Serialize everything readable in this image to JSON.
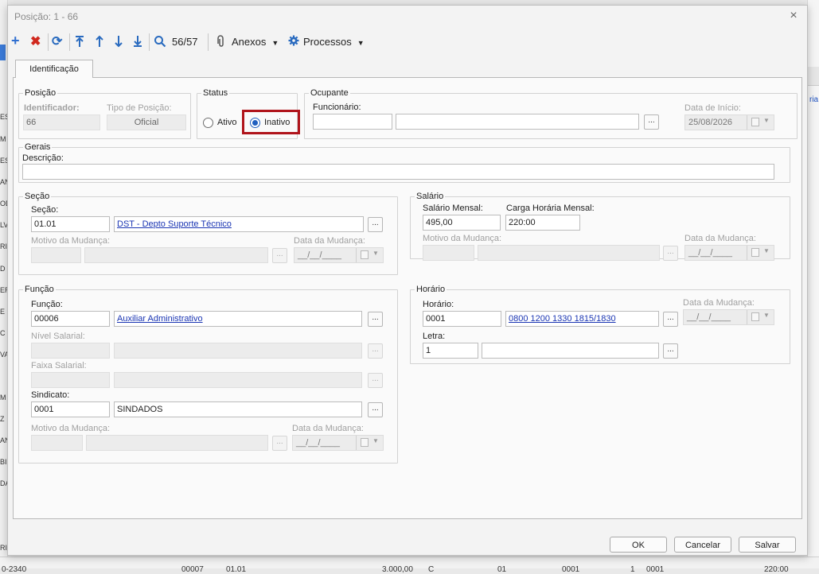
{
  "dialog": {
    "title": "Posição: 1 - 66",
    "close_icon": "×"
  },
  "toolbar": {
    "record_counter": "56/57",
    "anexos_label": "Anexos",
    "processos_label": "Processos",
    "icons": [
      "add-icon",
      "delete-icon",
      "refresh-icon",
      "first-record-icon",
      "previous-record-icon",
      "next-record-icon",
      "last-record-icon",
      "search-icon",
      "paperclip-icon",
      "gear-icon"
    ],
    "colors": {
      "add": "#2f6fd0",
      "delete": "#d0281e",
      "nav": "#2a6bbf"
    }
  },
  "tabs": [
    {
      "label": "Identificação"
    }
  ],
  "posicao": {
    "legend": "Posição",
    "identificador_label": "Identificador:",
    "identificador_value": "66",
    "tipo_label": "Tipo de Posição:",
    "tipo_value": "Oficial"
  },
  "status": {
    "legend": "Status",
    "ativo_label": "Ativo",
    "inativo_label": "Inativo",
    "selected": "Inativo",
    "highlight_color": "#b0141b"
  },
  "ocupante": {
    "legend": "Ocupante",
    "funcionario_label": "Funcionário:",
    "funcionario_code": "",
    "funcionario_name": "",
    "data_inicio_label": "Data de Início:",
    "data_inicio_value": "25/08/2026"
  },
  "gerais": {
    "legend": "Gerais",
    "descricao_label": "Descrição:",
    "descricao_value": ""
  },
  "secao": {
    "legend": "Seção",
    "secao_label": "Seção:",
    "secao_code": "01.01",
    "secao_name": "DST - Depto Suporte Técnico",
    "motivo_label": "Motivo da Mudança:",
    "data_mudanca_label": "Data da Mudança:",
    "data_mudanca_value": "__/__/____"
  },
  "salario": {
    "legend": "Salário",
    "salario_mensal_label": "Salário Mensal:",
    "salario_mensal_value": "495,00",
    "carga_label": "Carga Horária Mensal:",
    "carga_value": "220:00",
    "motivo_label": "Motivo da Mudança:",
    "data_mudanca_label": "Data da Mudança:",
    "data_mudanca_value": "__/__/____"
  },
  "funcao": {
    "legend": "Função",
    "funcao_label": "Função:",
    "funcao_code": "00006",
    "funcao_name": "Auxiliar Administrativo",
    "nivel_label": "Nível Salarial:",
    "faixa_label": "Faixa Salarial:",
    "sindicato_label": "Sindicato:",
    "sindicato_code": "0001",
    "sindicato_name": "SINDADOS",
    "motivo_label": "Motivo da Mudança:",
    "data_mudanca_label": "Data da Mudança:",
    "data_mudanca_value": "__/__/____"
  },
  "horario": {
    "legend": "Horário",
    "horario_label": "Horário:",
    "horario_code": "0001",
    "horario_name": "0800 1200 1330 1815/1830",
    "data_mudanca_label": "Data da Mudança:",
    "data_mudanca_value": "__/__/____",
    "letra_label": "Letra:",
    "letra_value": "1"
  },
  "footer": {
    "ok_label": "OK",
    "cancel_label": "Cancelar",
    "save_label": "Salvar"
  },
  "background": {
    "left_fragments": [
      "ES",
      "M",
      "ES",
      "AN",
      "OD",
      "LV",
      "RI",
      "D",
      "ER",
      "E",
      "C",
      "VA",
      "M",
      "Z",
      "AN",
      "BI",
      "DA",
      "RI"
    ],
    "right_link": "ria",
    "bottom_row": [
      "0-2340",
      "00007",
      "01.01",
      "3.000,00",
      "C",
      "01",
      "0001",
      "1",
      "0001",
      "220:00"
    ]
  }
}
